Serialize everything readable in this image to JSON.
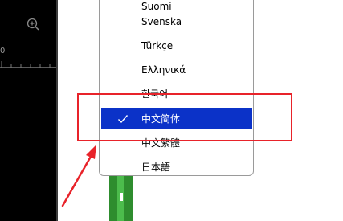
{
  "toolbar": {
    "zoom_icon": "zoom-in-icon",
    "ruler_label": "0"
  },
  "language_menu": {
    "items": [
      {
        "label": "Suomi",
        "selected": false
      },
      {
        "label": "Svenska",
        "selected": false
      },
      {
        "label": "Türkçe",
        "selected": false
      },
      {
        "label": "Ελληνικά",
        "selected": false
      },
      {
        "label": "한국어",
        "selected": false
      },
      {
        "label": "中文简体",
        "selected": true
      },
      {
        "label": "中文繁體",
        "selected": false
      },
      {
        "label": "日本語",
        "selected": false
      }
    ],
    "check_icon": "checkmark-icon"
  },
  "annotation": {
    "color": "#e8232a",
    "target": "中文简体"
  },
  "colors": {
    "selection": "#0b32c8",
    "panel": "#000000",
    "green": "#2e8d2e"
  }
}
